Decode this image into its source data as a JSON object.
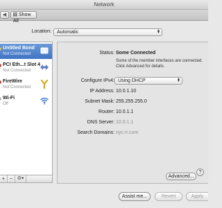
{
  "window": {
    "title": "Network"
  },
  "toolbar": {
    "back_glyph": "◀",
    "forward_glyph": "▶",
    "show_all_label": "Show All"
  },
  "location": {
    "label": "Location:",
    "value": "Automatic"
  },
  "services": [
    {
      "name": "Untitled Bond",
      "status": "Not Connected",
      "dot_color": "#d6c93a",
      "icon": "bond-icon"
    },
    {
      "name": "PCI Eth...t Slot 4",
      "status": "Not Connected",
      "dot_color": "#d43b2f",
      "icon": "ethernet-arrows-icon"
    },
    {
      "name": "FireWire",
      "status": "Not Connected",
      "dot_color": "#d43b2f",
      "icon": "firewire-icon"
    },
    {
      "name": "Wi-Fi",
      "status": "Off",
      "dot_color": "#b8b8b8",
      "icon": "wifi-icon"
    }
  ],
  "sidebar_controls": {
    "add": "+",
    "remove": "−",
    "gear": "⚙▾"
  },
  "detail": {
    "status_label": "Status:",
    "status_value": "Some Connected",
    "status_description": "Some of the member interfaces are connected. Click Advanced for details.",
    "configure_label": "Configure IPv4:",
    "configure_value": "Using DHCP",
    "ip_label": "IP Address:",
    "ip_value": "10.0.1.10",
    "subnet_label": "Subnet Mask:",
    "subnet_value": "255.255.255.0",
    "router_label": "Router:",
    "router_value": "10.0.1.1",
    "dns_label": "DNS Server:",
    "dns_value": "10.0.1.1",
    "search_label": "Search Domains:",
    "search_value": "nyc.rr.com",
    "advanced_label": "Advanced...",
    "help_label": "?"
  },
  "footer": {
    "assist_label": "Assist me...",
    "revert_label": "Revert",
    "apply_label": "Apply"
  },
  "colors": {
    "selection": "#3f73c3",
    "status_connected": "#d6c93a",
    "status_disconnected": "#d43b2f",
    "status_off": "#b8b8b8"
  }
}
